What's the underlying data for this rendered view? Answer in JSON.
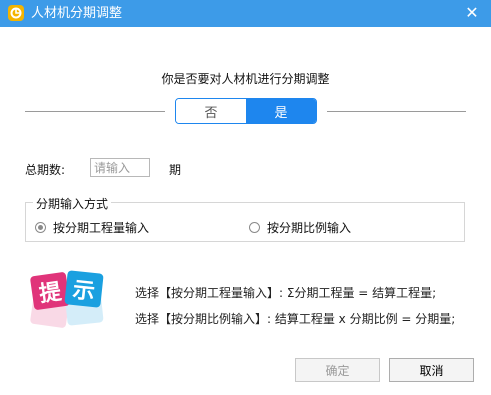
{
  "window": {
    "title": "人材机分期调整",
    "close_glyph": "✕",
    "icon": "app-logo-icon",
    "title_bar_color": "#3d9be8"
  },
  "question": "你是否要对人材机进行分期调整",
  "toggle": {
    "no_label": "否",
    "yes_label": "是",
    "selected": "是",
    "accent_color": "#1e86ee"
  },
  "periods": {
    "label": "总期数:",
    "placeholder": "请输入",
    "value": "",
    "unit": "期"
  },
  "input_mode": {
    "legend": "分期输入方式",
    "options": [
      {
        "label": "按分期工程量输入",
        "checked": true
      },
      {
        "label": "按分期比例输入",
        "checked": false
      }
    ]
  },
  "hint": {
    "badge_chars": [
      "提",
      "示"
    ],
    "lines": [
      "选择【按分期工程量输入】: Σ分期工程量 = 结算工程量;",
      "选择【按分期比例输入】: 结算工程量 x 分期比例 = 分期量;"
    ]
  },
  "buttons": {
    "ok_label": "确定",
    "ok_enabled": false,
    "cancel_label": "取消"
  }
}
